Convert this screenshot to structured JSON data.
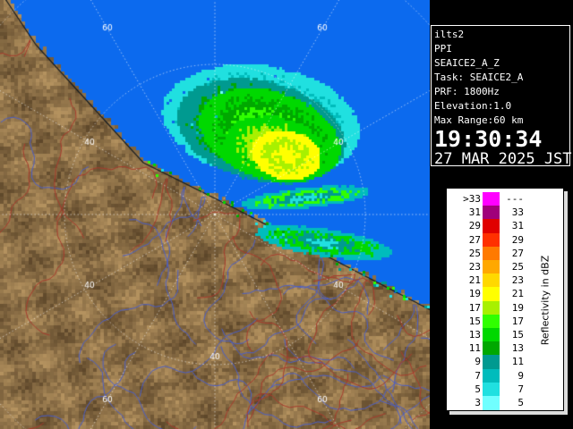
{
  "map": {
    "range_labels": [
      "60",
      "60",
      "40",
      "40",
      "40",
      "40",
      "40",
      "60",
      "60"
    ],
    "colors": {
      "sea": "#0c6aee",
      "land_dark": "#5a4428",
      "land_light": "#a88c5c",
      "river": "#4a5ec8",
      "border": "#a83a2c",
      "range_ring": "#ffffff"
    }
  },
  "info": {
    "site": "ilts2",
    "scan_type": "PPI",
    "product": "SEAICE2_A_Z",
    "task": "Task: SEAICE2_A",
    "prf": "PRF: 1800Hz",
    "elevation": "Elevation:1.0",
    "max_range": "Max Range:60 km",
    "time": "19:30:34",
    "date": "27 MAR 2025 JST"
  },
  "legend": {
    "unit_label": "Reflectivity in dBZ",
    "rows": [
      {
        "low": ">33",
        "high": "---",
        "color": "#ff00ff"
      },
      {
        "low": "31",
        "high": "33",
        "color": "#a0007a"
      },
      {
        "low": "29",
        "high": "31",
        "color": "#e00000"
      },
      {
        "low": "27",
        "high": "29",
        "color": "#ff3000"
      },
      {
        "low": "25",
        "high": "27",
        "color": "#ff7a00"
      },
      {
        "low": "23",
        "high": "25",
        "color": "#ffa800"
      },
      {
        "low": "21",
        "high": "23",
        "color": "#ffd800"
      },
      {
        "low": "19",
        "high": "21",
        "color": "#ffff00"
      },
      {
        "low": "17",
        "high": "19",
        "color": "#a8f000"
      },
      {
        "low": "15",
        "high": "17",
        "color": "#30ff00"
      },
      {
        "low": "13",
        "high": "15",
        "color": "#00d800"
      },
      {
        "low": "11",
        "high": "13",
        "color": "#00a800"
      },
      {
        "low": "9",
        "high": "11",
        "color": "#009a90"
      },
      {
        "low": "7",
        "high": "9",
        "color": "#00bcbc"
      },
      {
        "low": "5",
        "high": "7",
        "color": "#20e0e0"
      },
      {
        "low": "3",
        "high": "5",
        "color": "#70ffff"
      }
    ]
  }
}
